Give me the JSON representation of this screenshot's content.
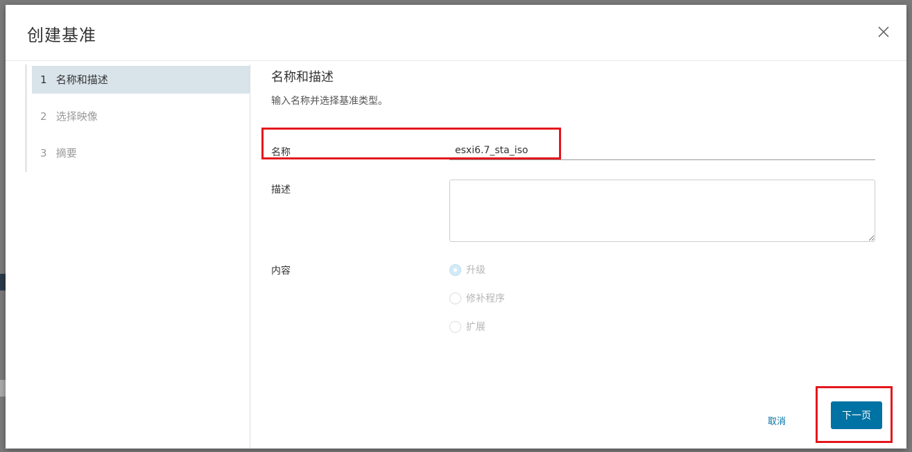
{
  "dialog": {
    "title": "创建基准"
  },
  "steps": [
    {
      "num": "1",
      "label": "名称和描述",
      "active": true
    },
    {
      "num": "2",
      "label": "选择映像",
      "active": false
    },
    {
      "num": "3",
      "label": "摘要",
      "active": false
    }
  ],
  "content": {
    "section_title": "名称和描述",
    "section_desc": "输入名称并选择基准类型。",
    "name_label": "名称",
    "name_value": "esxi6.7_sta_iso",
    "description_label": "描述",
    "description_value": "",
    "content_label": "内容",
    "content_options": [
      {
        "label": "升级",
        "checked": true
      },
      {
        "label": "修补程序",
        "checked": false
      },
      {
        "label": "扩展",
        "checked": false
      }
    ]
  },
  "footer": {
    "cancel_label": "取消",
    "next_label": "下一页"
  },
  "colors": {
    "primary": "#0072a3",
    "active_step_bg": "#d8e3ea",
    "highlight": "#e4161c"
  },
  "icons": {
    "close": "close-icon"
  }
}
